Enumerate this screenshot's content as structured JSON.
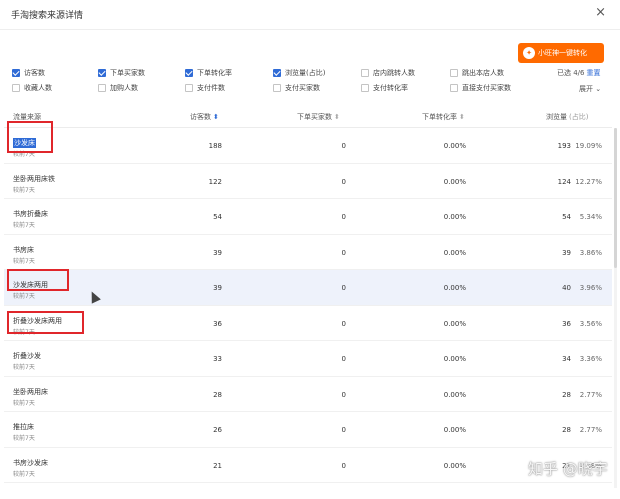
{
  "dialog": {
    "title": "手淘搜索来源详情",
    "close_icon": "close-icon",
    "promo_label": "小旺神一键转化"
  },
  "metrics": {
    "row1": [
      {
        "label": "访客数",
        "checked": true
      },
      {
        "label": "下单买家数",
        "checked": true
      },
      {
        "label": "下单转化率",
        "checked": true
      },
      {
        "label": "浏览量(占比)",
        "checked": true
      },
      {
        "label": "店内跳转人数",
        "checked": false
      },
      {
        "label": "跳出本店人数",
        "checked": false
      }
    ],
    "row2": [
      {
        "label": "收藏人数",
        "checked": false
      },
      {
        "label": "加购人数",
        "checked": false
      },
      {
        "label": "支付件数",
        "checked": false
      },
      {
        "label": "支付买家数",
        "checked": false
      },
      {
        "label": "支付转化率",
        "checked": false
      },
      {
        "label": "直接支付买家数",
        "checked": false
      }
    ],
    "selected_text": "已选 4/6",
    "reset_label": "重置",
    "collapse_label": "展开"
  },
  "table": {
    "headers": {
      "source": "流量来源",
      "visitors": "访客数",
      "buyers": "下单买家数",
      "conversion": "下单转化率",
      "pageviews": "浏览量",
      "share": "(占比)"
    },
    "rows": [
      {
        "keyword": "沙发床",
        "sub": "较前7天",
        "visitors": "188",
        "buyers": "0",
        "rate": "0.00%",
        "pv": "193",
        "pct": "19.09%"
      },
      {
        "keyword": "坐卧两用床铁",
        "sub": "较前7天",
        "visitors": "122",
        "buyers": "0",
        "rate": "0.00%",
        "pv": "124",
        "pct": "12.27%"
      },
      {
        "keyword": "书房折叠床",
        "sub": "较前7天",
        "visitors": "54",
        "buyers": "0",
        "rate": "0.00%",
        "pv": "54",
        "pct": "5.34%"
      },
      {
        "keyword": "书房床",
        "sub": "较前7天",
        "visitors": "39",
        "buyers": "0",
        "rate": "0.00%",
        "pv": "39",
        "pct": "3.86%"
      },
      {
        "keyword": "沙发床两用",
        "sub": "较前7天",
        "visitors": "39",
        "buyers": "0",
        "rate": "0.00%",
        "pv": "40",
        "pct": "3.96%"
      },
      {
        "keyword": "折叠沙发床两用",
        "sub": "较前7天",
        "visitors": "36",
        "buyers": "0",
        "rate": "0.00%",
        "pv": "36",
        "pct": "3.56%"
      },
      {
        "keyword": "折叠沙发",
        "sub": "较前7天",
        "visitors": "33",
        "buyers": "0",
        "rate": "0.00%",
        "pv": "34",
        "pct": "3.36%"
      },
      {
        "keyword": "坐卧两用床",
        "sub": "较前7天",
        "visitors": "28",
        "buyers": "0",
        "rate": "0.00%",
        "pv": "28",
        "pct": "2.77%"
      },
      {
        "keyword": "推拉床",
        "sub": "较前7天",
        "visitors": "26",
        "buyers": "0",
        "rate": "0.00%",
        "pv": "28",
        "pct": "2.77%"
      },
      {
        "keyword": "书房沙发床",
        "sub": "较前7天",
        "visitors": "21",
        "buyers": "0",
        "rate": "0.00%",
        "pv": "21",
        "pct": "2.08%"
      }
    ]
  },
  "watermark": "知乎 @晓宇",
  "colors": {
    "accent": "#2f6bd6",
    "promo": "#ff6a00",
    "highlight_box": "#e0262b",
    "row_highlight": "#eef2fb"
  }
}
